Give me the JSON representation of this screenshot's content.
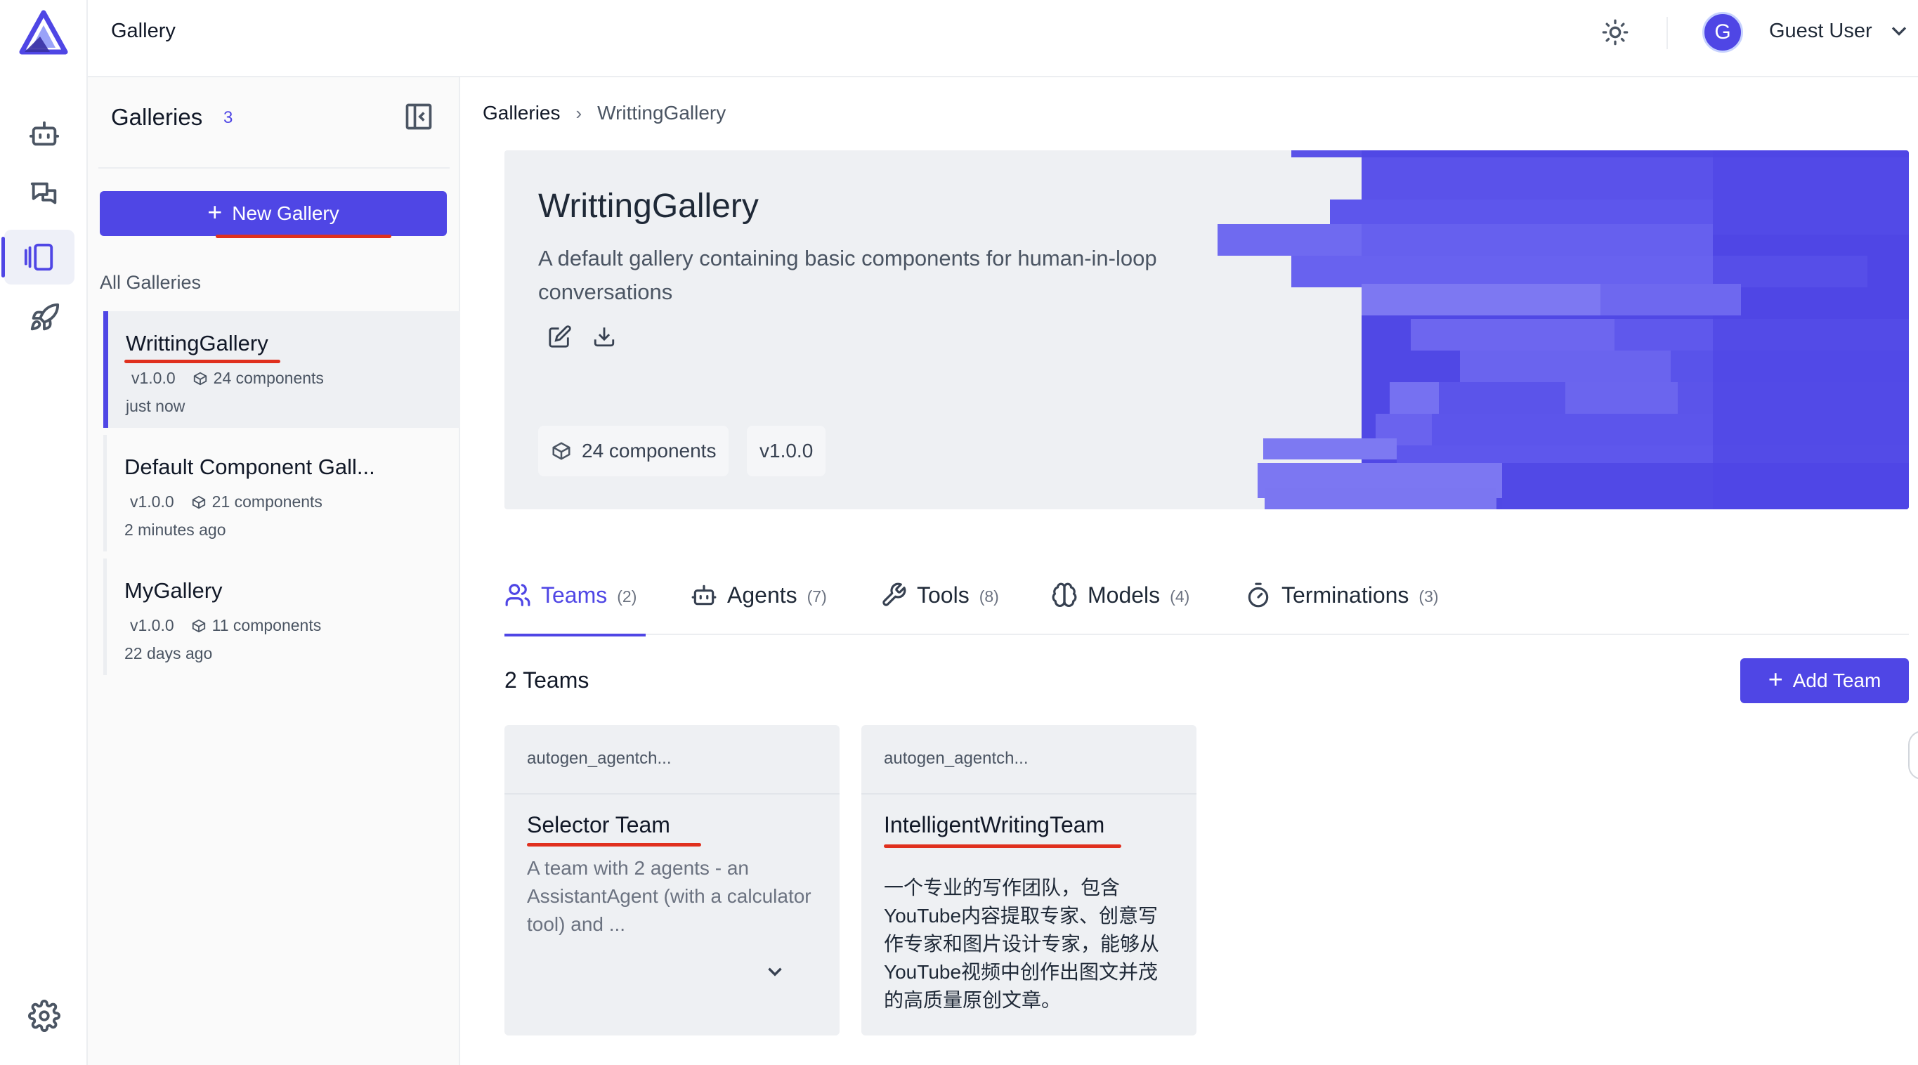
{
  "app": {
    "title": "Gallery"
  },
  "user": {
    "initial": "G",
    "name": "Guest User"
  },
  "sidebar": {
    "title": "Galleries",
    "count": "3",
    "new_button": "New Gallery",
    "section_label": "All Galleries",
    "items": [
      {
        "name": "WrittingGallery",
        "version": "v1.0.0",
        "components": "24 components",
        "time": "just now",
        "active": true
      },
      {
        "name": "Default Component Gall...",
        "version": "v1.0.0",
        "components": "21 components",
        "time": "2 minutes ago",
        "active": false
      },
      {
        "name": "MyGallery",
        "version": "v1.0.0",
        "components": "11 components",
        "time": "22 days ago",
        "active": false
      }
    ]
  },
  "breadcrumb": {
    "root": "Galleries",
    "current": "WrittingGallery"
  },
  "hero": {
    "title": "WrittingGallery",
    "description": "A default gallery containing basic components for human-in-loop conversations",
    "components_badge": "24 components",
    "version_badge": "v1.0.0",
    "accent": "#4f46e5"
  },
  "tabs": [
    {
      "label": "Teams",
      "count": "(2)",
      "icon": "users-icon",
      "active": true
    },
    {
      "label": "Agents",
      "count": "(7)",
      "icon": "bot-icon",
      "active": false
    },
    {
      "label": "Tools",
      "count": "(8)",
      "icon": "wrench-icon",
      "active": false
    },
    {
      "label": "Models",
      "count": "(4)",
      "icon": "brain-icon",
      "active": false
    },
    {
      "label": "Terminations",
      "count": "(3)",
      "icon": "timer-icon",
      "active": false
    }
  ],
  "teams": {
    "heading": "2 Teams",
    "add_button": "Add Team",
    "cards": [
      {
        "provider": "autogen_agentch...",
        "name": "Selector Team",
        "description": "A team with 2 agents - an AssistantAgent (with a calculator tool) and ..."
      },
      {
        "provider": "autogen_agentch...",
        "name": "IntelligentWritingTeam",
        "description": "一个专业的写作团队，包含YouTube内容提取专家、创意写作专家和图片设计专家，能够从YouTube视频中创作出图文并茂的高质量原创文章。"
      }
    ]
  }
}
